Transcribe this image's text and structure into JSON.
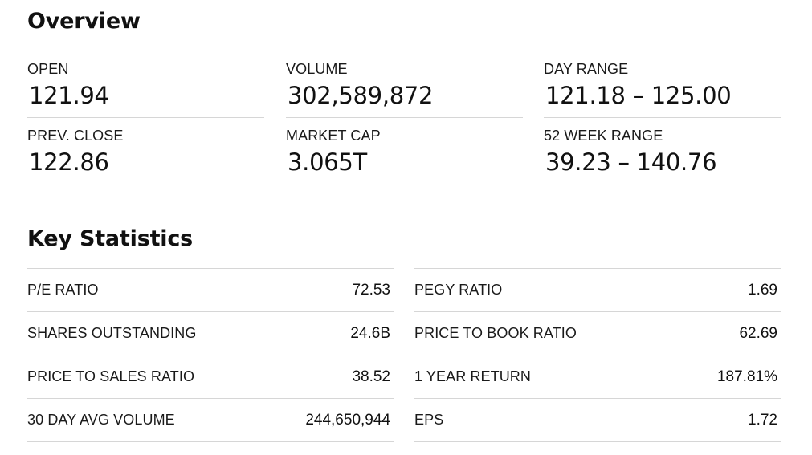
{
  "overview": {
    "title": "Overview",
    "columns": [
      [
        {
          "label": "OPEN",
          "value": "121.94"
        },
        {
          "label": "PREV. CLOSE",
          "value": "122.86"
        }
      ],
      [
        {
          "label": "VOLUME",
          "value": "302,589,872"
        },
        {
          "label": "MARKET CAP",
          "value": "3.065T"
        }
      ],
      [
        {
          "label": "DAY RANGE",
          "value": "121.18 – 125.00"
        },
        {
          "label": "52 WEEK RANGE",
          "value": "39.23 – 140.76"
        }
      ]
    ]
  },
  "key_statistics": {
    "title": "Key Statistics",
    "columns": [
      [
        {
          "label": "P/E RATIO",
          "value": "72.53"
        },
        {
          "label": "SHARES OUTSTANDING",
          "value": "24.6B"
        },
        {
          "label": "PRICE TO SALES RATIO",
          "value": "38.52"
        },
        {
          "label": "30 DAY AVG VOLUME",
          "value": "244,650,944"
        }
      ],
      [
        {
          "label": "PEGY RATIO",
          "value": "1.69"
        },
        {
          "label": "PRICE TO BOOK RATIO",
          "value": "62.69"
        },
        {
          "label": "1 YEAR RETURN",
          "value": "187.81%"
        },
        {
          "label": "EPS",
          "value": "1.72"
        }
      ]
    ]
  }
}
